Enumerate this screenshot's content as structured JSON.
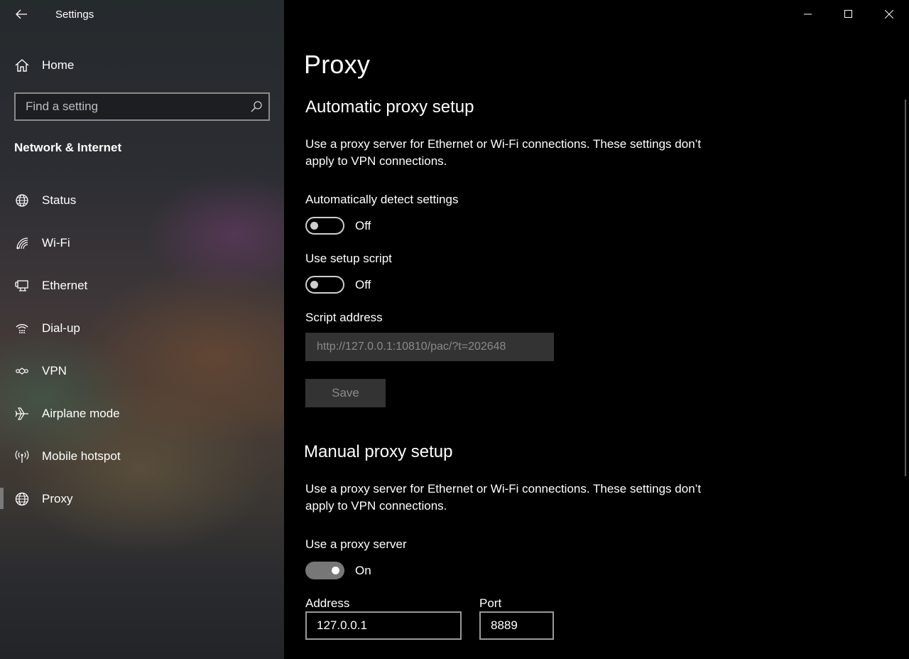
{
  "window": {
    "title": "Settings",
    "controls": {
      "minimize": "minimize-icon",
      "maximize": "maximize-icon",
      "close": "close-icon"
    }
  },
  "sidebar": {
    "back_icon": "back-arrow-icon",
    "home_label": "Home",
    "search": {
      "placeholder": "Find a setting",
      "value": ""
    },
    "section_heading": "Network & Internet",
    "items": [
      {
        "label": "Status",
        "icon": "globe-status-icon"
      },
      {
        "label": "Wi-Fi",
        "icon": "wifi-icon"
      },
      {
        "label": "Ethernet",
        "icon": "ethernet-icon"
      },
      {
        "label": "Dial-up",
        "icon": "dialup-icon"
      },
      {
        "label": "VPN",
        "icon": "vpn-icon"
      },
      {
        "label": "Airplane mode",
        "icon": "airplane-icon"
      },
      {
        "label": "Mobile hotspot",
        "icon": "hotspot-icon"
      },
      {
        "label": "Proxy",
        "icon": "globe-icon",
        "selected": true
      }
    ]
  },
  "main": {
    "page_title": "Proxy",
    "automatic": {
      "heading": "Automatic proxy setup",
      "description": "Use a proxy server for Ethernet or Wi-Fi connections. These settings don’t apply to VPN connections.",
      "auto_detect": {
        "label": "Automatically detect settings",
        "state": "Off",
        "on": false
      },
      "setup_script": {
        "label": "Use setup script",
        "state": "Off",
        "on": false
      },
      "script_address": {
        "label": "Script address",
        "value": "http://127.0.0.1:10810/pac/?t=202648"
      },
      "save_label": "Save"
    },
    "manual": {
      "heading": "Manual proxy setup",
      "description": "Use a proxy server for Ethernet or Wi-Fi connections. These settings don’t apply to VPN connections.",
      "use_proxy": {
        "label": "Use a proxy server",
        "state": "On",
        "on": true
      },
      "address": {
        "label": "Address",
        "value": "127.0.0.1"
      },
      "port": {
        "label": "Port",
        "value": "8889"
      }
    }
  },
  "colors": {
    "background": "#000000",
    "disabled_field": "#333333",
    "disabled_text": "#8a8a8a",
    "toggle_on": "#777777"
  }
}
